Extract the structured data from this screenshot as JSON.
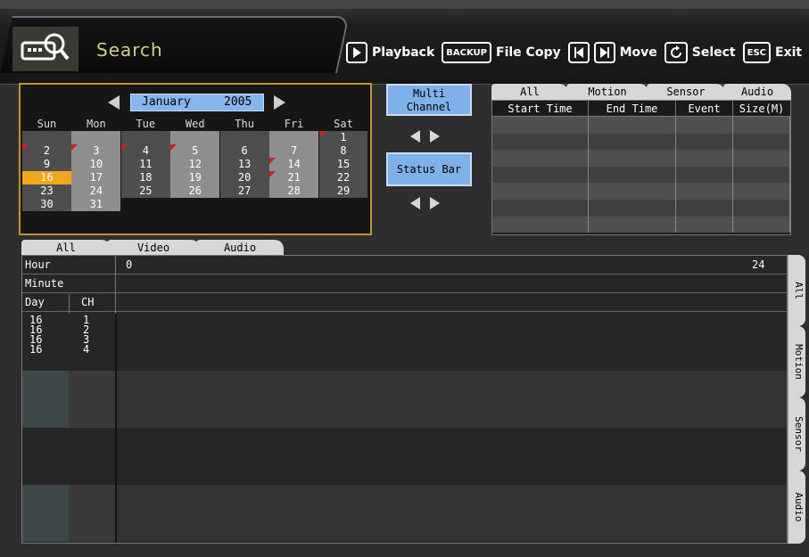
{
  "header": {
    "title": "Search",
    "help": [
      {
        "key": "▶",
        "label": "Playback"
      },
      {
        "key": "BACKUP",
        "label": "File Copy"
      },
      {
        "key": "|◀ ▶|",
        "label": "Move"
      },
      {
        "key": "↻",
        "label": "Select"
      },
      {
        "key": "ESC",
        "label": "Exit"
      }
    ]
  },
  "calendar": {
    "month": "January",
    "year": "2005",
    "weekdays": [
      "Sun",
      "Mon",
      "Tue",
      "Wed",
      "Thu",
      "Fri",
      "Sat"
    ],
    "selected_day": "16",
    "weeks": [
      [
        "",
        "",
        "",
        "",
        "",
        "",
        "1"
      ],
      [
        "2",
        "3",
        "4",
        "5",
        "6",
        "7",
        "8"
      ],
      [
        "9",
        "10",
        "11",
        "12",
        "13",
        "14",
        "15"
      ],
      [
        "16",
        "17",
        "18",
        "19",
        "20",
        "21",
        "22"
      ],
      [
        "23",
        "24",
        "25",
        "26",
        "27",
        "28",
        "29"
      ],
      [
        "30",
        "31",
        "",
        "",
        "",
        "",
        ""
      ]
    ]
  },
  "buttons": {
    "multi_channel_line1": "Multi",
    "multi_channel_line2": "Channel",
    "status_bar": "Status Bar"
  },
  "event_list": {
    "tabs": [
      "All",
      "Motion",
      "Sensor",
      "Audio"
    ],
    "columns": [
      "Start Time",
      "End Time",
      "Event",
      "Size(M)"
    ]
  },
  "timeline": {
    "tabs": [
      "All",
      "Video",
      "Audio"
    ],
    "hour_label": "Hour",
    "minute_label": "Minute",
    "day_label": "Day",
    "ch_label": "CH",
    "hour_start": "0",
    "hour_end": "24",
    "records": [
      {
        "day": "16",
        "ch": "1"
      },
      {
        "day": "16",
        "ch": "2"
      },
      {
        "day": "16",
        "ch": "3"
      },
      {
        "day": "16",
        "ch": "4"
      }
    ],
    "side_tabs": [
      "All",
      "Motion",
      "Sensor",
      "Audio"
    ]
  },
  "colors": {
    "accent_blue": "#87b6ee",
    "selected_orange": "#f2a61c",
    "record_mark_red": "#d42020",
    "calendar_border": "#c8922a",
    "title_text": "#cfcf88"
  }
}
